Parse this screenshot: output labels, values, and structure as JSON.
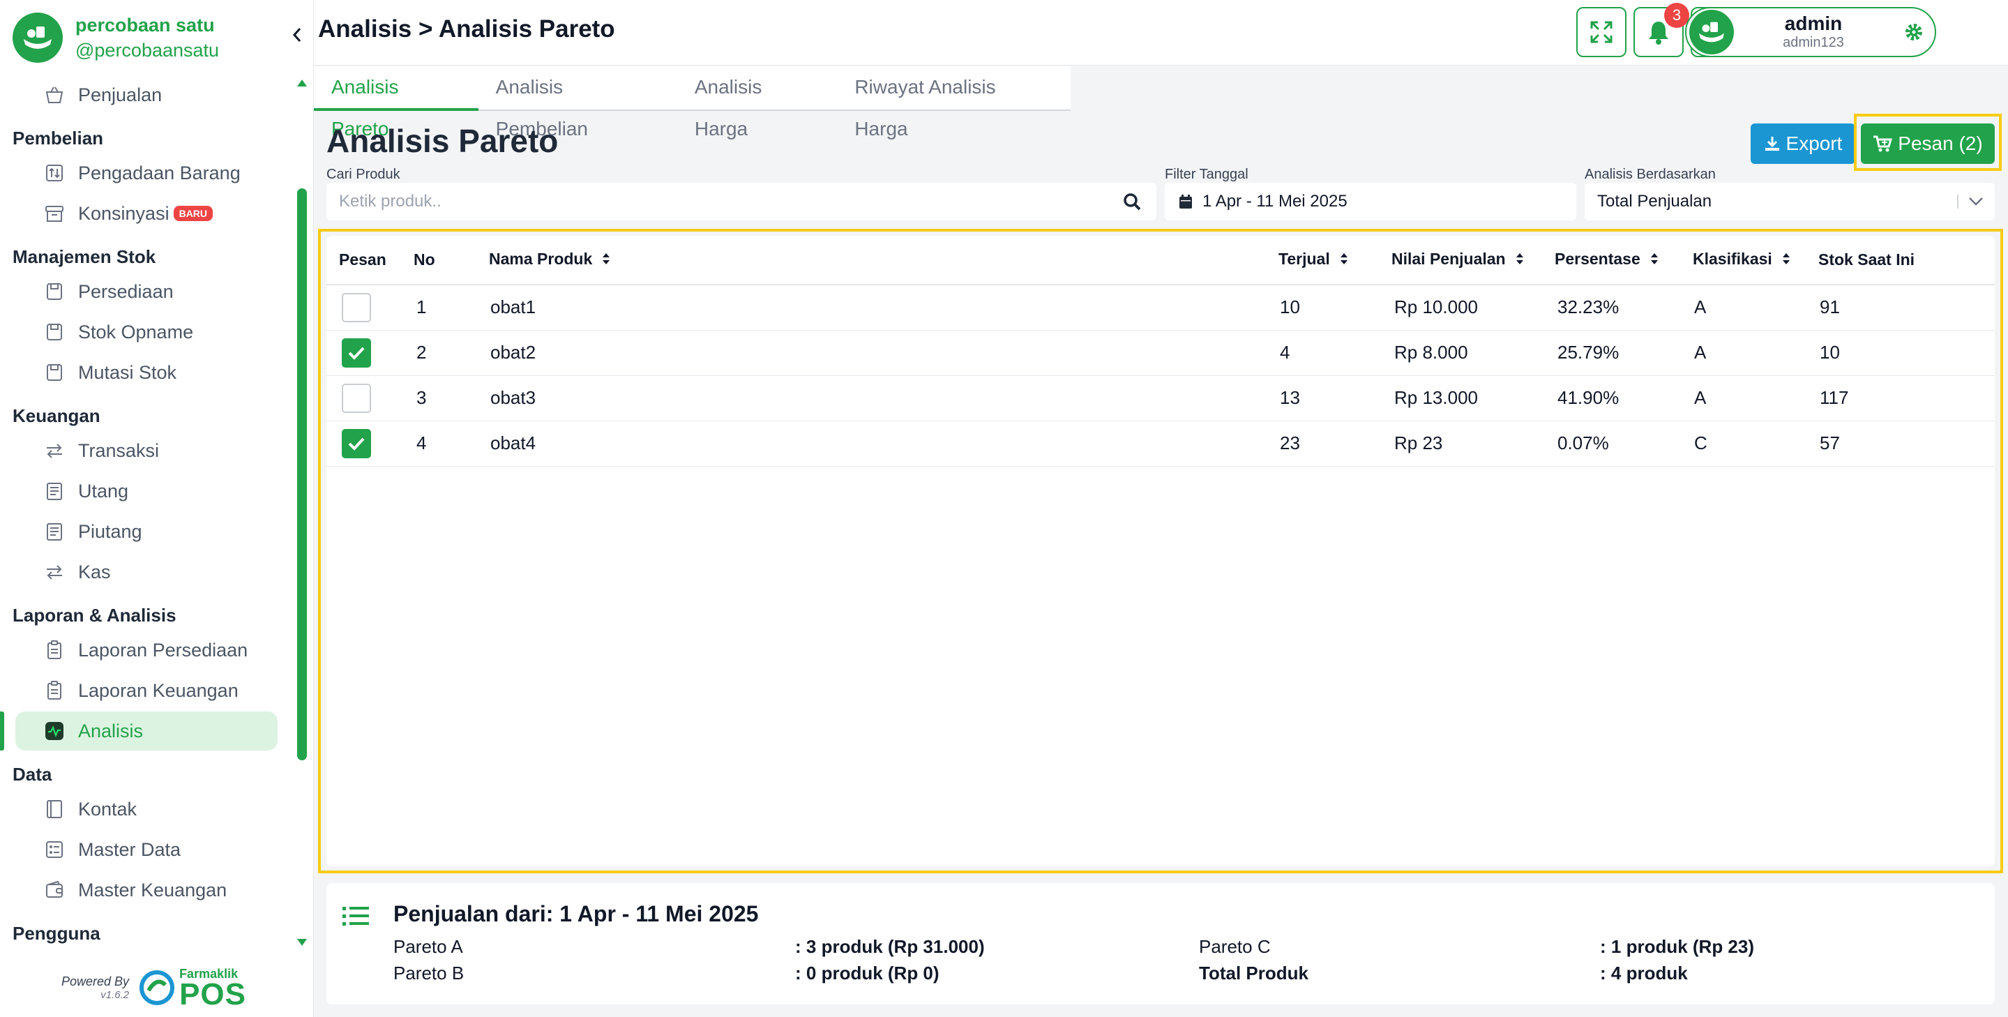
{
  "brand": {
    "name": "percobaan satu",
    "handle": "@percobaansatu"
  },
  "nav": {
    "top_item": "Penjualan",
    "sections": [
      {
        "title": "Pembelian",
        "items": [
          "Pengadaan Barang",
          "Konsinyasi"
        ]
      },
      {
        "title": "Manajemen Stok",
        "items": [
          "Persediaan",
          "Stok Opname",
          "Mutasi Stok"
        ]
      },
      {
        "title": "Keuangan",
        "items": [
          "Transaksi",
          "Utang",
          "Piutang",
          "Kas"
        ]
      },
      {
        "title": "Laporan & Analisis",
        "items": [
          "Laporan Persediaan",
          "Laporan Keuangan",
          "Analisis"
        ]
      },
      {
        "title": "Data",
        "items": [
          "Kontak",
          "Master Data",
          "Master Keuangan"
        ]
      },
      {
        "title": "Pengguna",
        "items": []
      }
    ],
    "new_badge": "BARU",
    "active_item": "Analisis"
  },
  "powered": {
    "label": "Powered By",
    "version": "v1.6.2",
    "logo_top": "Farmaklik",
    "logo_bottom": "POS"
  },
  "header": {
    "breadcrumb": "Analisis > Analisis Pareto",
    "notification_count": "3",
    "user_name": "admin",
    "user_sub": "admin123"
  },
  "tabs": [
    "Analisis Pareto",
    "Analisis Pembelian",
    "Analisis Harga",
    "Riwayat Analisis Harga"
  ],
  "page": {
    "title": "Analisis Pareto",
    "export_label": "Export",
    "pesan_label": "Pesan (2)"
  },
  "filters": {
    "search_label": "Cari Produk",
    "search_placeholder": "Ketik produk..",
    "date_label": "Filter Tanggal",
    "date_value": "1 Apr - 11 Mei 2025",
    "analysis_label": "Analisis Berdasarkan",
    "analysis_value": "Total Penjualan"
  },
  "table": {
    "columns": [
      "Pesan",
      "No",
      "Nama Produk",
      "Terjual",
      "Nilai Penjualan",
      "Persentase",
      "Klasifikasi",
      "Stok Saat Ini"
    ],
    "rows": [
      {
        "checked": false,
        "no": "1",
        "name": "obat1",
        "sold": "10",
        "value": "Rp 10.000",
        "percent": "32.23%",
        "class": "A",
        "stock": "91"
      },
      {
        "checked": true,
        "no": "2",
        "name": "obat2",
        "sold": "4",
        "value": "Rp 8.000",
        "percent": "25.79%",
        "class": "A",
        "stock": "10"
      },
      {
        "checked": false,
        "no": "3",
        "name": "obat3",
        "sold": "13",
        "value": "Rp 13.000",
        "percent": "41.90%",
        "class": "A",
        "stock": "117"
      },
      {
        "checked": true,
        "no": "4",
        "name": "obat4",
        "sold": "23",
        "value": "Rp 23",
        "percent": "0.07%",
        "class": "C",
        "stock": "57"
      }
    ]
  },
  "summary": {
    "title": "Penjualan dari: 1 Apr - 11 Mei 2025",
    "pareto_a_label": "Pareto A",
    "pareto_a_value": ": 3 produk (Rp 31.000)",
    "pareto_b_label": "Pareto B",
    "pareto_b_value": ": 0 produk (Rp 0)",
    "pareto_c_label": "Pareto C",
    "pareto_c_value": ": 1 produk (Rp 23)",
    "total_label": "Total Produk",
    "total_value": ": 4 produk"
  },
  "colors": {
    "accent": "#22a24a",
    "export": "#1b96d2",
    "highlight": "#facc15",
    "badge": "#ef4444"
  }
}
